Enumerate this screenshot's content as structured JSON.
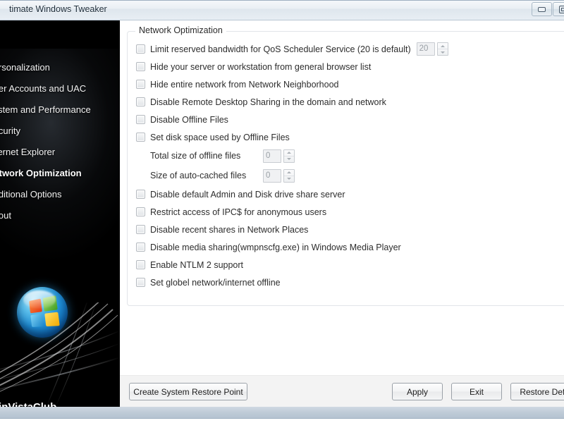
{
  "window": {
    "title": "timate Windows Tweaker",
    "controls": [
      {
        "name": "minimize",
        "icon": "minimize-icon"
      },
      {
        "name": "maximize",
        "icon": "maximize-icon"
      }
    ]
  },
  "sidebar": {
    "brand": "WinVistaClub",
    "logo": "windows-vista-orb-logo",
    "items": [
      {
        "label": "Personalization",
        "active": false
      },
      {
        "label": "User Accounts and UAC",
        "active": false
      },
      {
        "label": "System and Performance",
        "active": false
      },
      {
        "label": "Security",
        "active": false
      },
      {
        "label": "Internet Explorer",
        "active": false
      },
      {
        "label": "Network Optimization",
        "active": true
      },
      {
        "label": "Additional Options",
        "active": false
      },
      {
        "label": "About",
        "active": false
      }
    ]
  },
  "main": {
    "groupbox_title": "Network Optimization",
    "options": [
      {
        "label": "Limit reserved bandwidth for QoS Scheduler Service (20 is default)",
        "checked": false,
        "spinner": {
          "value": "20",
          "disabled": true
        }
      },
      {
        "label": "Hide your server or workstation from general browser list",
        "checked": false
      },
      {
        "label": "Hide entire network from Network Neighborhood",
        "checked": false
      },
      {
        "label": "Disable Remote Desktop Sharing in the domain and network",
        "checked": false
      },
      {
        "label": "Disable Offline Files",
        "checked": false
      },
      {
        "label": "Set disk space used by Offline Files",
        "checked": false
      }
    ],
    "sub_options": [
      {
        "label": "Total size of offline files",
        "spinner": {
          "value": "0",
          "disabled": true
        }
      },
      {
        "label": "Size of auto-cached files",
        "spinner": {
          "value": "0",
          "disabled": true
        }
      }
    ],
    "options_2": [
      {
        "label": "Disable default Admin and Disk drive share server",
        "checked": false
      },
      {
        "label": "Restrict access of IPC$ for anonymous users",
        "checked": false
      },
      {
        "label": "Disable recent shares in Network Places",
        "checked": false
      },
      {
        "label": "Disable media sharing(wmpnscfg.exe) in Windows Media Player",
        "checked": false
      },
      {
        "label": "Enable NTLM 2 support",
        "checked": false
      },
      {
        "label": "Set globel network/internet offline",
        "checked": false
      }
    ]
  },
  "footer": {
    "restore_point_label": "Create System Restore Point",
    "apply_label": "Apply",
    "exit_label": "Exit",
    "restore_defaults_label": "Restore Default"
  },
  "colors": {
    "sidebar_bg": "#000000",
    "titlebar": "#e8eef4",
    "content_bg": "#ffffff",
    "button_bar": "#f3f3f3",
    "frame": "#c0ccd8"
  }
}
